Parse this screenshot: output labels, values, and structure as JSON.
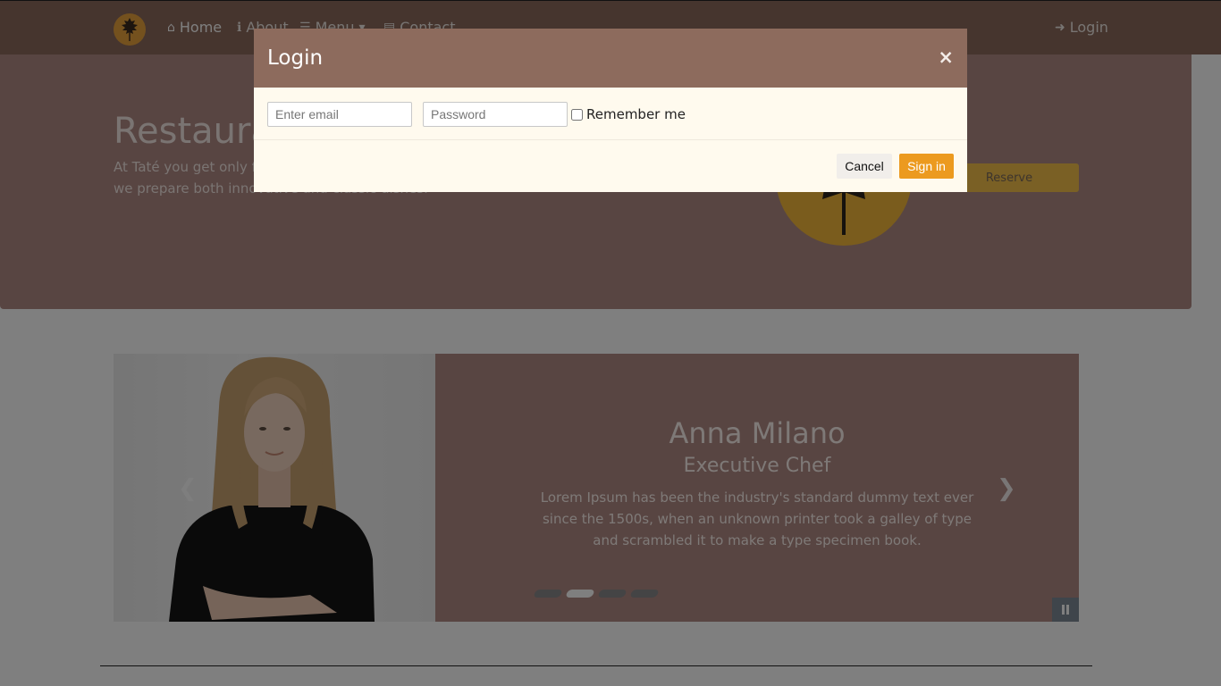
{
  "navbar": {
    "home": {
      "label": "Home",
      "icon": "home-icon"
    },
    "about": {
      "label": "About",
      "icon": "info-icon"
    },
    "menu": {
      "label": "Menu",
      "icon": "list-icon"
    },
    "contact": {
      "label": "Contact",
      "icon": "contact-card-icon"
    },
    "login": {
      "label": "Login",
      "icon": "sign-in-icon"
    }
  },
  "hero": {
    "title": "Restaurant Taté",
    "text_line1": "At Taté you get only first class food from our fine and varied menu where",
    "text_line2": "we prepare both innovative and classic dishes.",
    "reserve_label": "Reserve"
  },
  "carousel": {
    "name": "Anna Milano",
    "role": "Executive Chef",
    "description": "Lorem Ipsum has been the industry's standard dummy text ever since the 1500s, when an unknown printer took a galley of type and scrambled it to make a type specimen book.",
    "active_indicator": 2,
    "indicator_count": 4
  },
  "modal": {
    "title": "Login",
    "close_symbol": "×",
    "email_placeholder": "Enter email",
    "password_placeholder": "Password",
    "remember_label": "Remember me",
    "cancel_label": "Cancel",
    "signin_label": "Sign in"
  },
  "colors": {
    "brand_brown": "#8d6b5d",
    "accent_orange": "#ec9a1f",
    "modal_bg": "#fffaee"
  }
}
